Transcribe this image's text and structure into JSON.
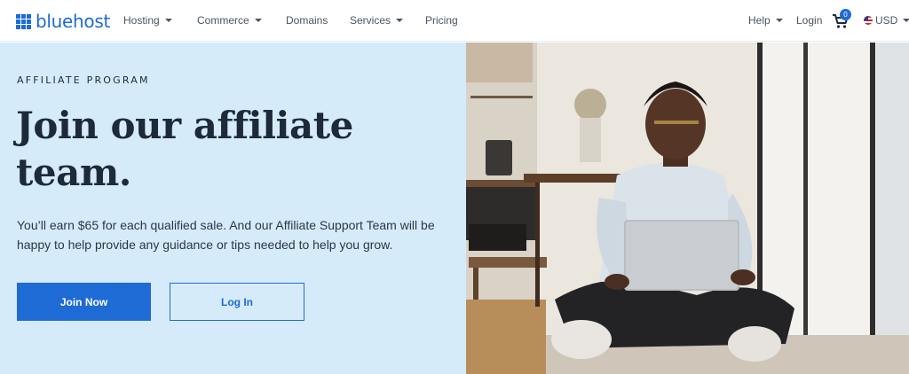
{
  "brand": {
    "name": "bluehost",
    "accent": "#1e6bd6"
  },
  "nav": {
    "items": [
      {
        "label": "Hosting",
        "dropdown": true
      },
      {
        "label": "Commerce",
        "dropdown": true
      },
      {
        "label": "Domains",
        "dropdown": false
      },
      {
        "label": "Services",
        "dropdown": true
      },
      {
        "label": "Pricing",
        "dropdown": false
      }
    ],
    "right": {
      "help": "Help",
      "login": "Login",
      "cart_count": "0",
      "currency": "USD"
    }
  },
  "hero": {
    "eyebrow": "AFFILIATE PROGRAM",
    "headline_line1": "Join our affiliate",
    "headline_line2": "team.",
    "body": "You’ll earn $65 for each qualified sale. And our Affiliate Support Team will be happy to help provide any guidance or tips needed to help you grow.",
    "primary_button": "Join Now",
    "secondary_button": "Log In",
    "background": "#d6ebfa"
  },
  "icons": {
    "logo": "grid-logo-icon",
    "cart": "cart-icon",
    "flag": "us-flag-icon",
    "caret": "chevron-down-icon"
  }
}
